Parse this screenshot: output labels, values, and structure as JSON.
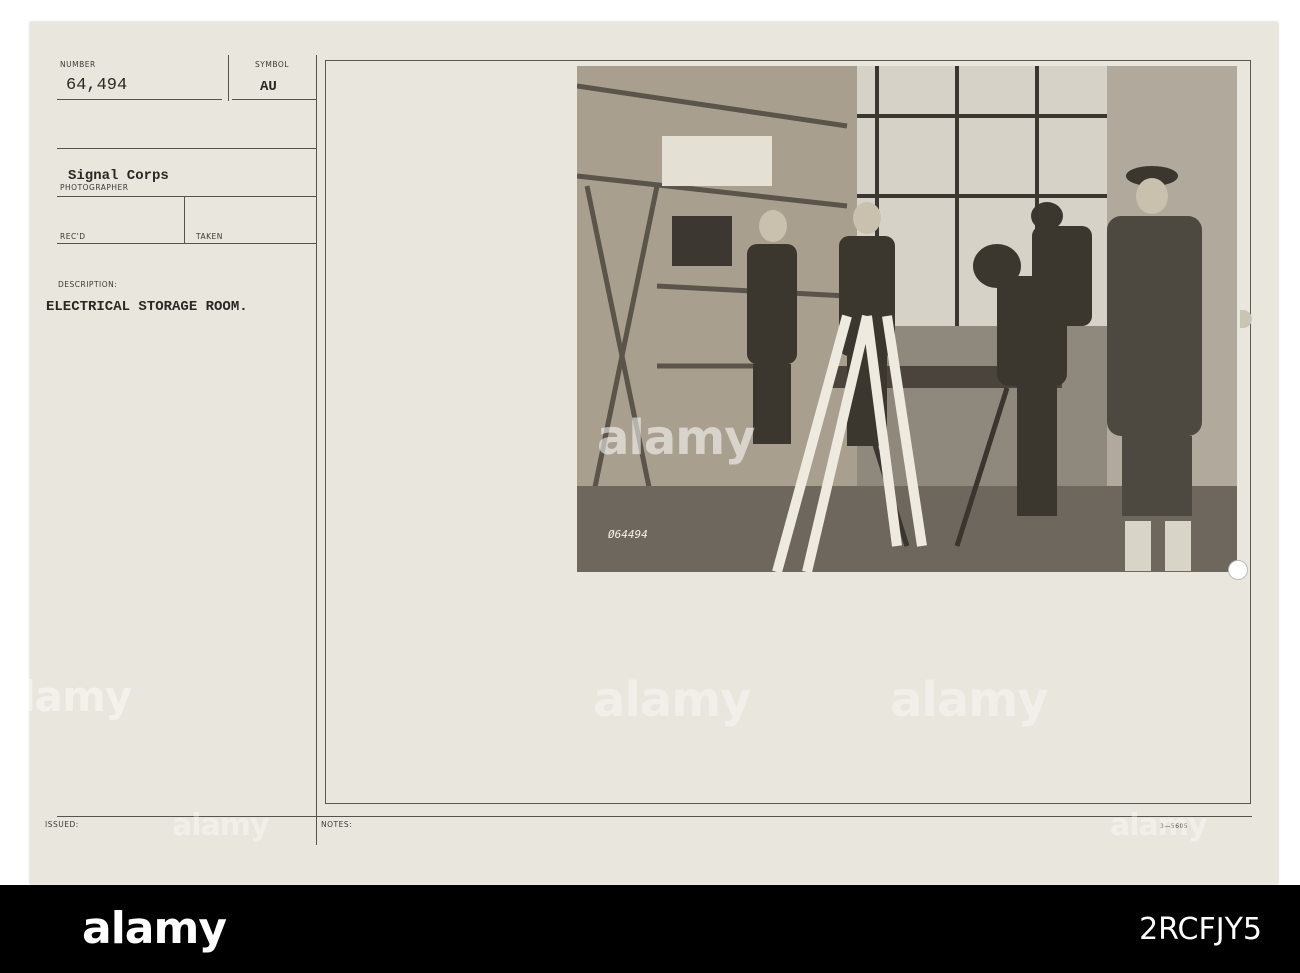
{
  "card": {
    "number_label": "NUMBER",
    "number_value": "64,494",
    "symbol_label": "SYMBOL",
    "symbol_value": "AU",
    "photographer_value": "Signal Corps",
    "photographer_label": "PHOTOGRAPHER",
    "recd_label": "REC'D",
    "taken_label": "TAKEN",
    "description_label": "DESCRIPTION:",
    "description_value": "ELECTRICAL STORAGE ROOM.",
    "issued_label": "ISSUED:",
    "notes_label": "NOTES:",
    "form_code": "3—5605"
  },
  "photo": {
    "negative_number": "Ø64494"
  },
  "watermark": {
    "text": "alamy"
  },
  "footer": {
    "logo": "alamy",
    "stock_id": "2RCFJY5"
  },
  "colors": {
    "card": "#e9e6dd",
    "rule": "#55534c",
    "footer": "#000000"
  }
}
